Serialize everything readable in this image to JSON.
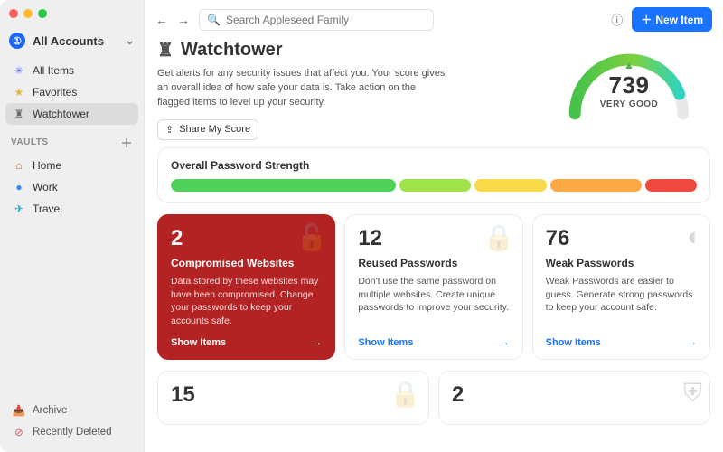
{
  "sidebar": {
    "accounts_label": "All Accounts",
    "nav": [
      {
        "label": "All Items",
        "icon": "✳︎",
        "color": "#5c77ff"
      },
      {
        "label": "Favorites",
        "icon": "★",
        "color": "#e7b63c"
      },
      {
        "label": "Watchtower",
        "icon": "♜",
        "color": "#6b6b6b",
        "active": true
      }
    ],
    "vaults_header": "VAULTS",
    "vaults": [
      {
        "label": "Home",
        "icon": "⌂",
        "color": "#e4572e"
      },
      {
        "label": "Work",
        "icon": "●",
        "color": "#2b8cff"
      },
      {
        "label": "Travel",
        "icon": "✈",
        "color": "#19a8c6"
      }
    ],
    "bottom": [
      {
        "label": "Archive",
        "icon": "📥"
      },
      {
        "label": "Recently Deleted",
        "icon": "⊘",
        "color": "#d25b5b"
      }
    ]
  },
  "toolbar": {
    "search_placeholder": "Search Appleseed Family",
    "new_item_label": "New Item"
  },
  "header": {
    "title": "Watchtower",
    "description": "Get alerts for any security issues that affect you. Your score gives an overall idea of how safe your data is. Take action on the flagged items to level up your security.",
    "share_label": "Share My Score"
  },
  "gauge": {
    "score": "739",
    "rating": "VERY GOOD"
  },
  "strength": {
    "title": "Overall Password Strength",
    "segments": [
      {
        "color": "#4fd15a",
        "pct": 44
      },
      {
        "color": "#9fe24a",
        "pct": 14
      },
      {
        "color": "#f7d94a",
        "pct": 14
      },
      {
        "color": "#fca946",
        "pct": 18
      },
      {
        "color": "#ef4a3e",
        "pct": 10
      }
    ]
  },
  "cards": [
    {
      "count": "2",
      "title": "Compromised Websites",
      "desc": "Data stored by these websites may have been compromised. Change your passwords to keep your accounts safe.",
      "link": "Show Items",
      "variant": "danger",
      "icon": "unlock"
    },
    {
      "count": "12",
      "title": "Reused Passwords",
      "desc": "Don't use the same password on multiple websites. Create unique passwords to improve your security.",
      "link": "Show Items",
      "icon": "lock"
    },
    {
      "count": "76",
      "title": "Weak Passwords",
      "desc": "Weak Passwords are easier to guess. Generate strong passwords to keep your account safe.",
      "link": "Show Items",
      "icon": "gauge"
    }
  ],
  "cards_row2": [
    {
      "count": "15",
      "icon": "lock"
    },
    {
      "count": "2",
      "icon": "shield"
    }
  ]
}
